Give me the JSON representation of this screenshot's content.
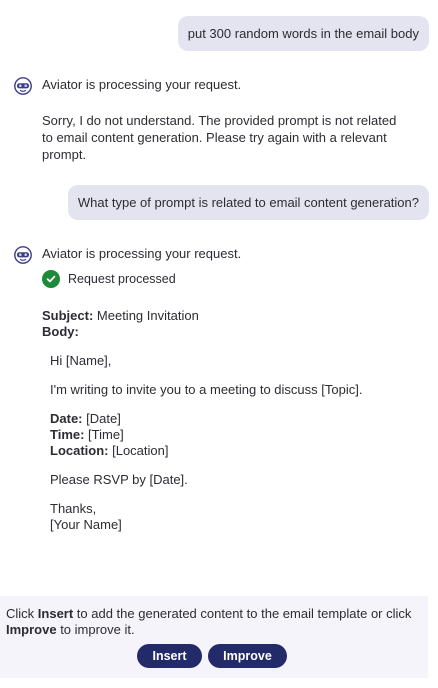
{
  "messages": {
    "user_1": "put 300 random words in the email body",
    "bot_1_status": "Aviator is processing your request.",
    "bot_1_text": "Sorry, I do not understand. The provided prompt is not related to email content generation. Please try again with a relevant prompt.",
    "user_2": "What type of prompt is related to email content generation?",
    "bot_2_status": "Aviator is processing your request.",
    "bot_2_processed": "Request processed"
  },
  "email": {
    "subject_label": "Subject:",
    "subject_value": " Meeting Invitation",
    "body_label": "Body:",
    "greeting": "Hi [Name],",
    "intro": "I'm writing to invite you to a meeting to discuss [Topic].",
    "date_label": "Date:",
    "date_value": " [Date]",
    "time_label": "Time:",
    "time_value": " [Time]",
    "location_label": "Location:",
    "location_value": " [Location]",
    "rsvp": "Please RSVP by [Date].",
    "closing": "Thanks,",
    "signature": "[Your Name]"
  },
  "footer": {
    "part1": "Click ",
    "insert_word": "Insert",
    "part2": " to add the generated content to the email template or click ",
    "improve_word": "Improve",
    "part3": " to improve it.",
    "insert_button": "Insert",
    "improve_button": "Improve"
  },
  "icons": {
    "bot_avatar": "aviator-bot-icon",
    "processed": "check-circle-icon"
  },
  "colors": {
    "user_bubble": "#e3e4ef",
    "button": "#232a6a",
    "success": "#1d8a3a",
    "footer_bg": "#f4f4fa"
  }
}
